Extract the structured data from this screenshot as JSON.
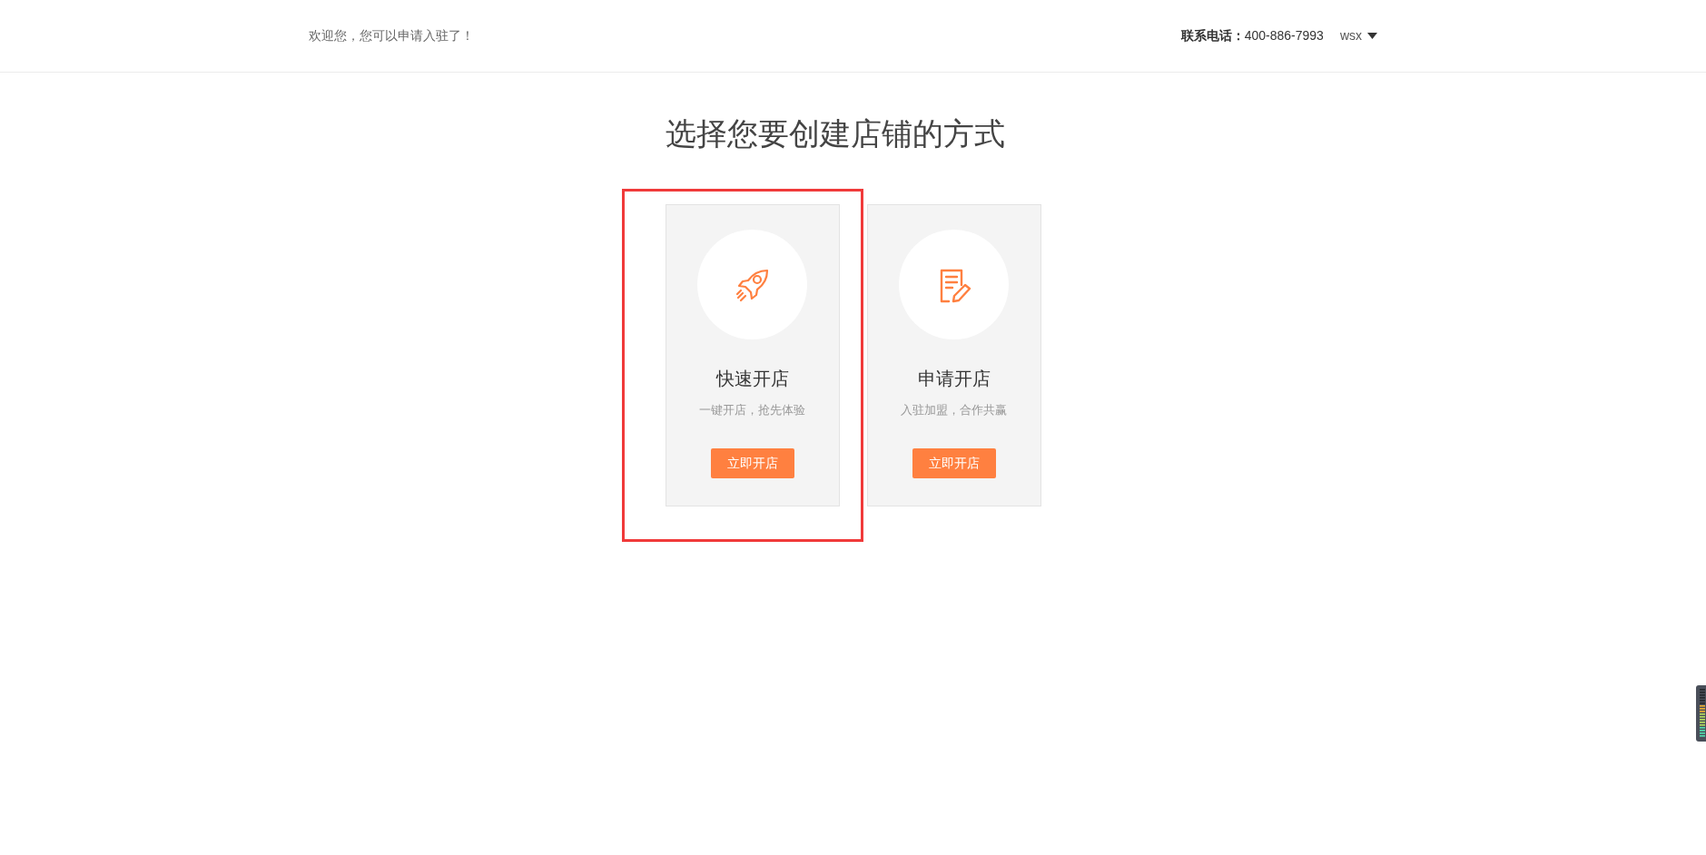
{
  "header": {
    "welcome": "欢迎您，您可以申请入驻了！",
    "phone_label": "联系电话：",
    "phone": "400-886-7993",
    "user": "wsx"
  },
  "title": "选择您要创建店铺的方式",
  "cards": [
    {
      "kind": "rocket",
      "title": "快速开店",
      "subtitle": "一键开店，抢先体验",
      "button": "立即开店",
      "highlighted": true
    },
    {
      "kind": "form",
      "title": "申请开店",
      "subtitle": "入驻加盟，合作共赢",
      "button": "立即开店",
      "highlighted": false
    }
  ]
}
